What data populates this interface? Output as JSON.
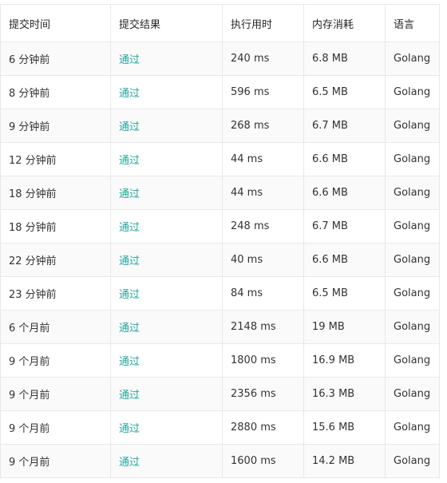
{
  "table": {
    "columns": [
      "提交时间",
      "提交结果",
      "执行用时",
      "内存消耗",
      "语言"
    ],
    "rows": [
      {
        "time": "6 分钟前",
        "result": "通过",
        "runtime": "240 ms",
        "memory": "6.8 MB",
        "language": "Golang"
      },
      {
        "time": "8 分钟前",
        "result": "通过",
        "runtime": "596 ms",
        "memory": "6.5 MB",
        "language": "Golang"
      },
      {
        "time": "9 分钟前",
        "result": "通过",
        "runtime": "268 ms",
        "memory": "6.7 MB",
        "language": "Golang"
      },
      {
        "time": "12 分钟前",
        "result": "通过",
        "runtime": "44 ms",
        "memory": "6.6 MB",
        "language": "Golang"
      },
      {
        "time": "18 分钟前",
        "result": "通过",
        "runtime": "44 ms",
        "memory": "6.6 MB",
        "language": "Golang"
      },
      {
        "time": "18 分钟前",
        "result": "通过",
        "runtime": "248 ms",
        "memory": "6.7 MB",
        "language": "Golang"
      },
      {
        "time": "22 分钟前",
        "result": "通过",
        "runtime": "40 ms",
        "memory": "6.6 MB",
        "language": "Golang"
      },
      {
        "time": "23 分钟前",
        "result": "通过",
        "runtime": "84 ms",
        "memory": "6.5 MB",
        "language": "Golang"
      },
      {
        "time": "6 个月前",
        "result": "通过",
        "runtime": "2148 ms",
        "memory": "19 MB",
        "language": "Golang"
      },
      {
        "time": "9 个月前",
        "result": "通过",
        "runtime": "1800 ms",
        "memory": "16.9 MB",
        "language": "Golang"
      },
      {
        "time": "9 个月前",
        "result": "通过",
        "runtime": "2356 ms",
        "memory": "16.3 MB",
        "language": "Golang"
      },
      {
        "time": "9 个月前",
        "result": "通过",
        "runtime": "2880 ms",
        "memory": "15.6 MB",
        "language": "Golang"
      },
      {
        "time": "9 个月前",
        "result": "通过",
        "runtime": "1600 ms",
        "memory": "14.2 MB",
        "language": "Golang"
      }
    ]
  },
  "colors": {
    "accepted": "#26a69a",
    "border": "#e8e8e8",
    "stripe": "#fafafa"
  }
}
